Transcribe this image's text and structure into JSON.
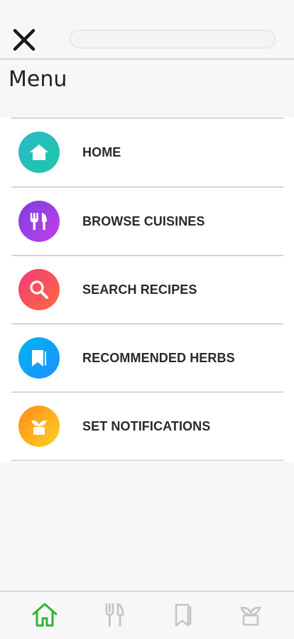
{
  "header": {
    "close_icon": "close-icon",
    "search": {
      "value": "",
      "placeholder": ""
    }
  },
  "page_title": "Menu",
  "menu": {
    "items": [
      {
        "label": "HOME",
        "icon": "home-icon",
        "gradient": [
          "#2ab8c8",
          "#1fc7a6"
        ]
      },
      {
        "label": "BROWSE CUISINES",
        "icon": "fork-knife-icon",
        "gradient": [
          "#7b3fe0",
          "#c040e8"
        ]
      },
      {
        "label": "SEARCH RECIPES",
        "icon": "search-icon",
        "gradient": [
          "#f23a7a",
          "#ff6b3d"
        ]
      },
      {
        "label": "RECOMMENDED HERBS",
        "icon": "bookmark-icon",
        "gradient": [
          "#00b5f0",
          "#1e8fff"
        ]
      },
      {
        "label": "SET NOTIFICATIONS",
        "icon": "plant-icon",
        "gradient": [
          "#ff8a1e",
          "#ffd21f"
        ]
      }
    ]
  },
  "bottom_nav": {
    "items": [
      {
        "icon": "home-icon",
        "active": true
      },
      {
        "icon": "fork-knife-icon",
        "active": false
      },
      {
        "icon": "bookmark-icon",
        "active": false
      },
      {
        "icon": "plant-icon",
        "active": false
      }
    ],
    "active_color": "#2fb52f",
    "inactive_color": "#c4c4c4"
  }
}
